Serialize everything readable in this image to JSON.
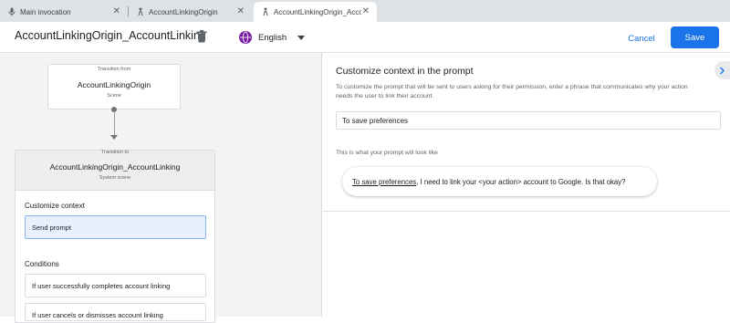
{
  "tabs": [
    {
      "label": "Main invocation",
      "icon": "microphone-icon",
      "close": "✕",
      "active": false
    },
    {
      "label": "AccountLinkingOrigin",
      "icon": "scene-person-icon",
      "close": "✕",
      "active": false
    },
    {
      "label": "AccountLinkingOrigin_Acco...",
      "icon": "scene-person-icon",
      "close": "✕",
      "active": true
    }
  ],
  "header": {
    "title": "AccountLinkingOrigin_AccountLinking",
    "language": "English",
    "cancel_label": "Cancel",
    "save_label": "Save"
  },
  "canvas": {
    "from_caption": "Transition from",
    "from_title": "AccountLinkingOrigin",
    "from_subtitle": "Scene",
    "to_caption": "Transition to",
    "to_title": "AccountLinkingOrigin_AccountLinking",
    "to_subtitle": "System scene",
    "customize_label": "Customize context",
    "send_prompt": "Send prompt",
    "conditions_label": "Conditions",
    "conditions": [
      "If user successfully completes account linking",
      "If user cancels or dismisses account linking"
    ]
  },
  "panel": {
    "title": "Customize context in the prompt",
    "description": "To customize the prompt that will be sent to users asking for their permission, enter a phrase that communicates why your action needs the user to link their account.",
    "input_value": "To save preferences",
    "preview_label": "This is what your prompt will look like",
    "preview_highlight": "To save preferences",
    "preview_rest": ", I need to link your <your action> account to Google. Is that okay?"
  },
  "colors": {
    "accent": "#1a73e8",
    "selected_bg": "#e8f0fe",
    "globe": "#7b1fa2"
  }
}
